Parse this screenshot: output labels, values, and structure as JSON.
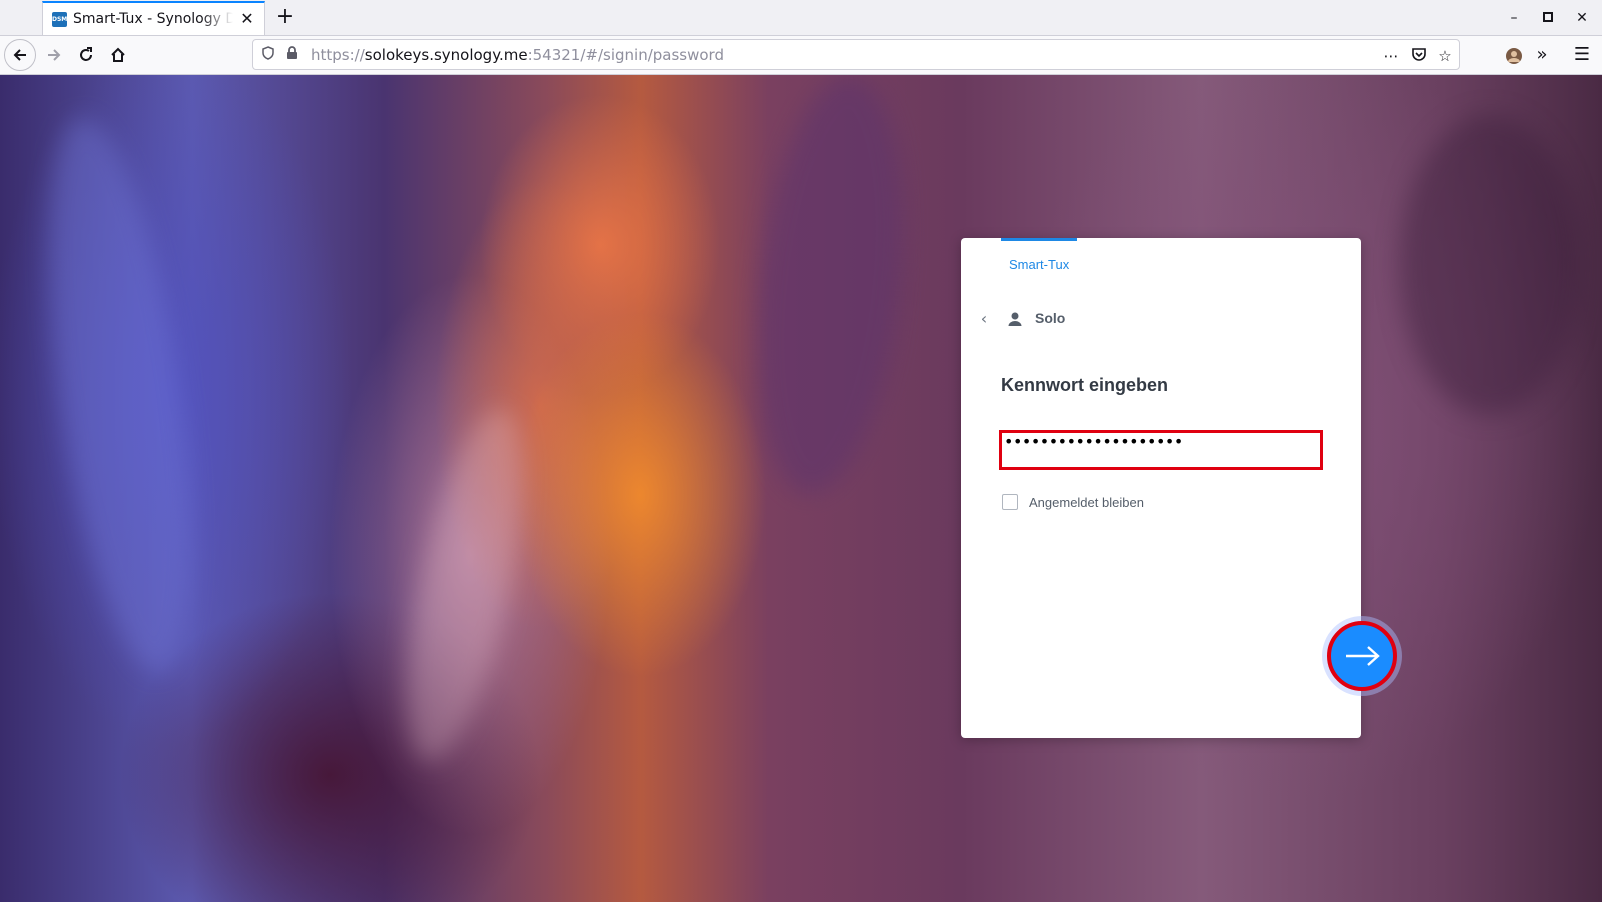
{
  "browser": {
    "tab": {
      "favicon_text": "DSM",
      "title": "Smart-Tux - Synology DiskStation",
      "close": "✕"
    },
    "new_tab": "+",
    "window_controls": {
      "minimize": "–",
      "maximize": "□",
      "close": "✕"
    },
    "url": {
      "scheme": "https://",
      "domain": "solokeys.synology.me",
      "rest": ":54321/#/signin/password"
    }
  },
  "login": {
    "server_name": "Smart-Tux",
    "username": "Solo",
    "heading": "Kennwort eingeben",
    "password_masked": "••••••••••••••••••••",
    "remember_label": "Angemeldet bleiben",
    "remember_checked": false
  },
  "colors": {
    "accent": "#1e88e5",
    "submit": "#1a8cff",
    "highlight": "#e00010"
  }
}
